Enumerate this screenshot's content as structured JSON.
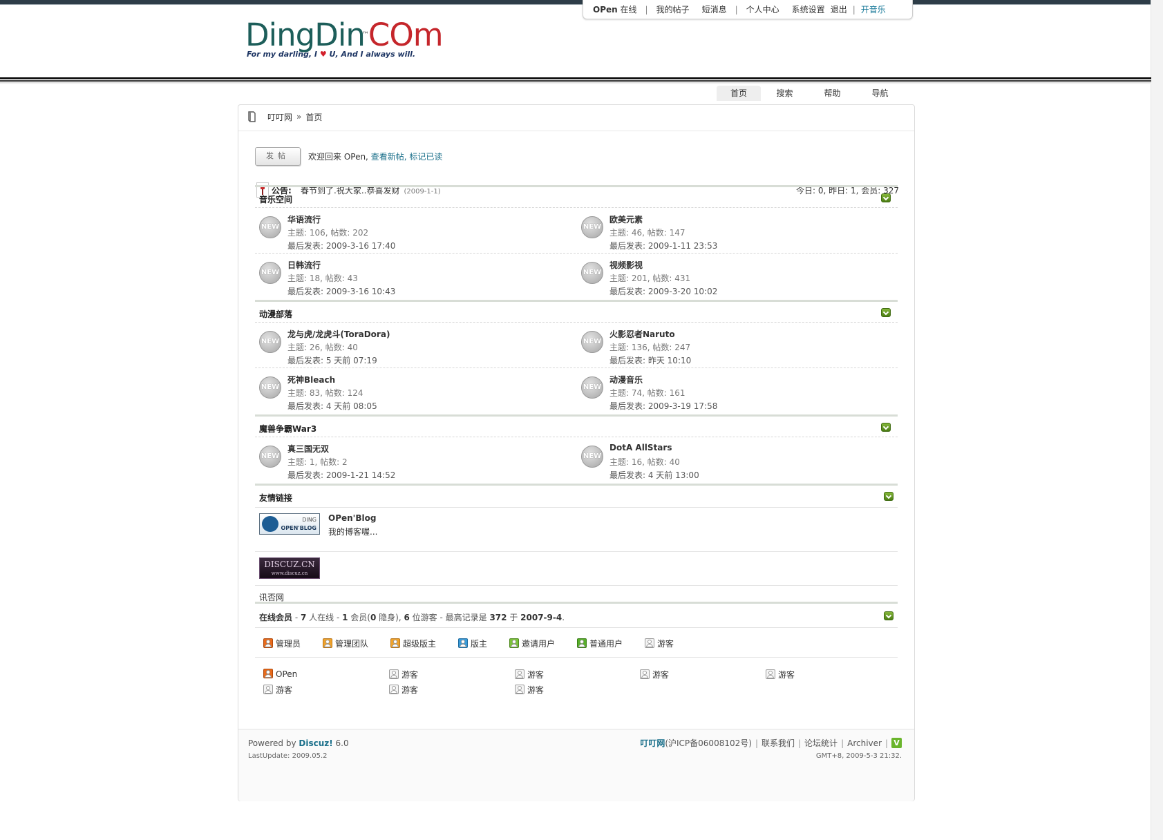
{
  "usermenu": {
    "username": "OPen",
    "status": "在线",
    "my_posts": "我的帖子",
    "messages": "短消息",
    "profile": "个人中心",
    "settings": "系统设置",
    "logout": "退出",
    "music": "开音乐"
  },
  "logo": {
    "part1": "DingDin",
    "tm": "™",
    "part2": "COm",
    "tagline_a": "For my darling, I ",
    "heart": "♥",
    "tagline_b": " U, And I always will."
  },
  "nav": [
    "首页",
    "搜索",
    "帮助",
    "导航"
  ],
  "breadcrumb": {
    "site": "叮叮网",
    "sep": "»",
    "current": "首页"
  },
  "post_button": "发帖",
  "welcome": {
    "prefix": "欢迎回来 OPen,",
    "new_posts": "查看新帖",
    "comma": ",",
    "mark_read": "标记已读"
  },
  "announcement": {
    "label": "公告:",
    "text": "春节到了.祝大家..恭喜发财",
    "date": "(2009-1-1)",
    "stats": "今日: 0, 昨日: 1, 会员: 327"
  },
  "categories": [
    {
      "title": "音乐空间",
      "rows": [
        [
          {
            "name": "华语流行",
            "stats": "主题: 106, 帖数: 202",
            "last": "最后发表: 2009-3-16 17:40"
          },
          {
            "name": "欧美元素",
            "stats": "主题: 46, 帖数: 147",
            "last": "最后发表: 2009-1-11 23:53"
          }
        ],
        [
          {
            "name": "日韩流行",
            "stats": "主题: 18, 帖数: 43",
            "last": "最后发表: 2009-3-16 10:43"
          },
          {
            "name": "视频影视",
            "stats": "主题: 201, 帖数: 431",
            "last": "最后发表: 2009-3-20 10:02"
          }
        ]
      ]
    },
    {
      "title": "动漫部落",
      "rows": [
        [
          {
            "name": "龙与虎/龙虎斗(ToraDora)",
            "stats": "主题: 26, 帖数: 40",
            "last": "最后发表: 5 天前 07:19"
          },
          {
            "name": "火影忍者Naruto",
            "stats": "主题: 136, 帖数: 247",
            "last": "最后发表: 昨天 10:10"
          }
        ],
        [
          {
            "name": "死神Bleach",
            "stats": "主题: 83, 帖数: 124",
            "last": "最后发表: 4 天前 08:05"
          },
          {
            "name": "动漫音乐",
            "stats": "主题: 74, 帖数: 161",
            "last": "最后发表: 2009-3-19 17:58"
          }
        ]
      ]
    },
    {
      "title": "魔兽争霸War3",
      "rows": [
        [
          {
            "name": "真三国无双",
            "stats": "主题: 1, 帖数: 2",
            "last": "最后发表: 2009-1-21 14:52"
          },
          {
            "name": "DotA AllStars",
            "stats": "主题: 16, 帖数: 40",
            "last": "最后发表: 4 天前 13:00"
          }
        ]
      ]
    }
  ],
  "new_badge": "NEW",
  "links": {
    "title": "友情链接",
    "blog_logo_top": "DING",
    "blog_logo_bottom": "OPEN'BLOG",
    "blog_name": "OPen'Blog",
    "blog_desc": "我的博客喔...",
    "discuz_logo": "DISCUZ.CN",
    "discuz_logo_small": "www.discuz.cn",
    "text_link": "讯否网"
  },
  "online": {
    "title": "在线会员",
    "summary_a": " - ",
    "total": "7",
    "summary_b": " 人在线 - ",
    "members": "1",
    "summary_c": " 会员(",
    "hidden": "0",
    "summary_d": " 隐身), ",
    "guests": "6",
    "summary_e": " 位游客 - 最高记录是 ",
    "record": "372",
    "summary_f": " 于 ",
    "record_date": "2007-9-4",
    "summary_g": ".",
    "legend": [
      "管理员",
      "管理团队",
      "超级版主",
      "版主",
      "邀请用户",
      "普通用户",
      "游客"
    ],
    "users": [
      "OPen",
      "游客",
      "游客",
      "游客",
      "游客",
      "游客",
      "游客",
      "游客"
    ]
  },
  "footer": {
    "powered": "Powered by ",
    "discuz": "Discuz!",
    "version": " 6.0",
    "lastupdate": "LastUpdate: 2009.05.2",
    "site": "叮叮网",
    "icp": " (沪ICP备06008102号)",
    "contact": "联系我们",
    "stats": "论坛统计",
    "archiver": "Archiver",
    "v": "V",
    "time": "GMT+8, 2009-5-3 21:32."
  }
}
